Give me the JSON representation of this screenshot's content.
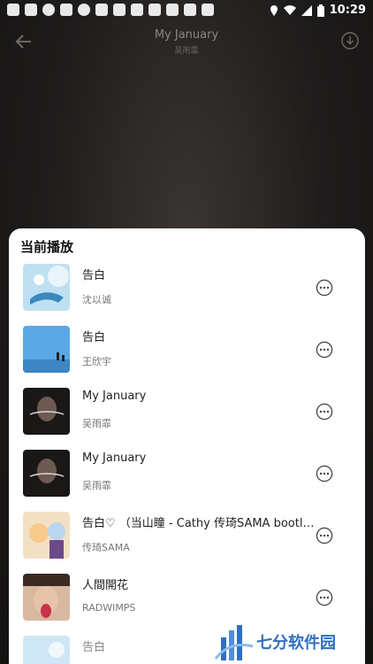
{
  "status_bar": {
    "time": "10:29"
  },
  "header": {
    "title": "My January",
    "subtitle": "吴雨霏"
  },
  "sheet": {
    "title": "当前播放",
    "items": [
      {
        "song": "告白",
        "artist": "沈以诚",
        "cover": "cover-blue-whale"
      },
      {
        "song": "告白",
        "artist": "王欣宇",
        "cover": "cover-blue-white"
      },
      {
        "song": "My January",
        "artist": "吴雨霏",
        "cover": "cover-dark-portrait"
      },
      {
        "song": "My January",
        "artist": "吴雨霏",
        "cover": "cover-dark-portrait"
      },
      {
        "song": "告白♡ （当山瞳 - Cathy 传琦SAMA bootle…",
        "artist": "传琦SAMA",
        "cover": "cover-anime"
      },
      {
        "song": "人間開花",
        "artist": "RADWIMPS",
        "cover": "cover-face"
      },
      {
        "song": "告白",
        "artist": "",
        "cover": "cover-light-blue"
      }
    ]
  },
  "watermark": {
    "text": "七分软件园"
  },
  "colors": {
    "sheet_bg": "#ffffff",
    "page_bg": "#1e1c1b",
    "watermark": "#2f6fc0"
  }
}
